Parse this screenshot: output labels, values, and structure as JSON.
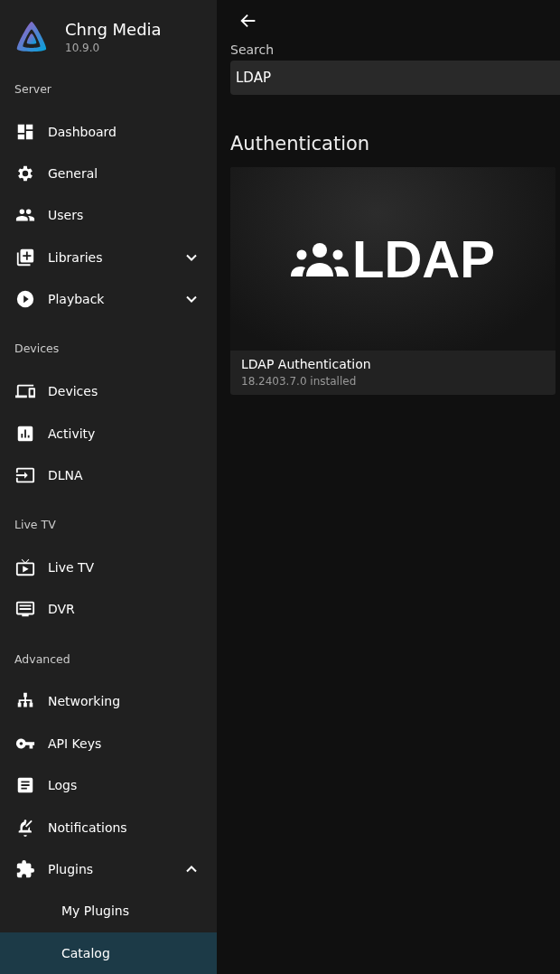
{
  "brand": {
    "name": "Chng Media",
    "version": "10.9.0"
  },
  "sidebar": {
    "sections": [
      {
        "title": "Server",
        "items": [
          {
            "label": "Dashboard",
            "selected": false
          },
          {
            "label": "General",
            "selected": false
          },
          {
            "label": "Users",
            "selected": false
          },
          {
            "label": "Libraries",
            "selected": false,
            "expanded": false
          },
          {
            "label": "Playback",
            "selected": false,
            "expanded": false
          }
        ]
      },
      {
        "title": "Devices",
        "items": [
          {
            "label": "Devices",
            "selected": false
          },
          {
            "label": "Activity",
            "selected": false
          },
          {
            "label": "DLNA",
            "selected": false
          }
        ]
      },
      {
        "title": "Live TV",
        "items": [
          {
            "label": "Live TV",
            "selected": false
          },
          {
            "label": "DVR",
            "selected": false
          }
        ]
      },
      {
        "title": "Advanced",
        "items": [
          {
            "label": "Networking",
            "selected": false
          },
          {
            "label": "API Keys",
            "selected": false
          },
          {
            "label": "Logs",
            "selected": false
          },
          {
            "label": "Notifications",
            "selected": false
          },
          {
            "label": "Plugins",
            "selected": false,
            "expanded": true,
            "children": [
              {
                "label": "My Plugins",
                "selected": false
              },
              {
                "label": "Catalog",
                "selected": true
              }
            ]
          }
        ]
      }
    ]
  },
  "search": {
    "label": "Search",
    "value": "LDAP"
  },
  "category": {
    "title": "Authentication",
    "plugins": [
      {
        "logo_text": "LDAP",
        "name": "LDAP Authentication",
        "status": "18.2403.7.0 installed"
      }
    ]
  }
}
